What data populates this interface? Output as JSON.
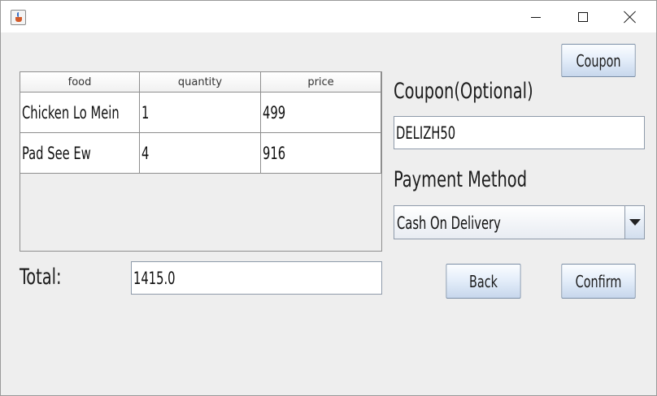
{
  "table": {
    "columns": [
      "food",
      "quantity",
      "price"
    ],
    "rows": [
      [
        "Chicken Lo Mein",
        "1",
        "499"
      ],
      [
        "Pad See Ew",
        "4",
        "916"
      ]
    ]
  },
  "total": {
    "label": "Total:",
    "value": "1415.0"
  },
  "coupon": {
    "button_label": "Coupon",
    "section_label": "Coupon(Optional)",
    "code": "DELIZH50"
  },
  "payment": {
    "label": "Payment Method",
    "selected": "Cash On Delivery"
  },
  "actions": {
    "back_label": "Back",
    "confirm_label": "Confirm"
  },
  "window_controls": [
    "minimize-icon",
    "maximize-icon",
    "close-icon"
  ],
  "colors": {
    "button_border": "#7a8ea6",
    "window_bg": "#eeeeee"
  }
}
